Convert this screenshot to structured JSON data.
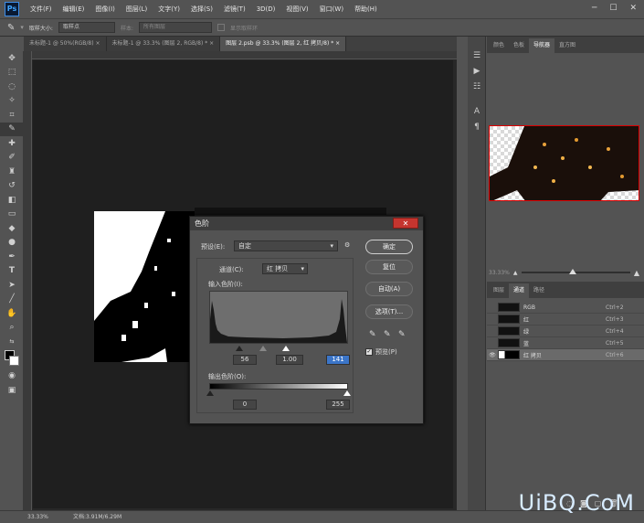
{
  "app": {
    "logo": "Ps"
  },
  "menu": [
    "文件(F)",
    "编辑(E)",
    "图像(I)",
    "图层(L)",
    "文字(Y)",
    "选择(S)",
    "滤镜(T)",
    "3D(D)",
    "视图(V)",
    "窗口(W)",
    "帮助(H)"
  ],
  "window_controls": [
    "─",
    "☐",
    "✕"
  ],
  "options": {
    "sample_size_label": "取样大小:",
    "sample_size_value": "取样点",
    "sample_label": "样本:",
    "sample_value": "所有图层",
    "show_ring": "显示取样环"
  },
  "tabs": [
    {
      "label": "未标题-1 @ 50%(RGB/8)",
      "close": "×"
    },
    {
      "label": "未标题-1 @ 33.3% (图层 2, RGB/8) *",
      "close": "×"
    },
    {
      "label": "图层 2.psb @ 33.3% (图层 2, 红 拷贝/8) *",
      "close": "×"
    }
  ],
  "nav_panel": {
    "tabs": [
      "颜色",
      "色板",
      "导航器",
      "直方图"
    ],
    "zoom": "33.33%"
  },
  "channels_panel": {
    "tabs": [
      "图层",
      "通道",
      "路径"
    ],
    "rows": [
      {
        "name": "RGB",
        "key": "Ctrl+2",
        "visible": false
      },
      {
        "name": "红",
        "key": "Ctrl+3",
        "visible": false
      },
      {
        "name": "绿",
        "key": "Ctrl+4",
        "visible": false
      },
      {
        "name": "蓝",
        "key": "Ctrl+5",
        "visible": false
      },
      {
        "name": "红 拷贝",
        "key": "Ctrl+6",
        "visible": true
      }
    ]
  },
  "dialog": {
    "title": "色阶",
    "close": "✕",
    "preset_label": "预设(E):",
    "preset_value": "自定",
    "channel_label": "通道(C):",
    "channel_value": "红 拷贝",
    "input_label": "输入色阶(I):",
    "input_values": [
      "56",
      "1.00",
      "141"
    ],
    "output_label": "输出色阶(O):",
    "output_values": [
      "0",
      "255"
    ],
    "buttons": {
      "ok": "确定",
      "reset": "复位",
      "auto": "自动(A)",
      "options": "选项(T)..."
    },
    "preview_label": "预览(P)",
    "preview_checked": true
  },
  "status": {
    "zoom": "33.33%",
    "doc": "文档:3.91M/6.29M"
  },
  "watermark": "UiBQ.CoM",
  "colors": {
    "dialog_close": "#c5352f",
    "selection": "#3b75c8"
  }
}
